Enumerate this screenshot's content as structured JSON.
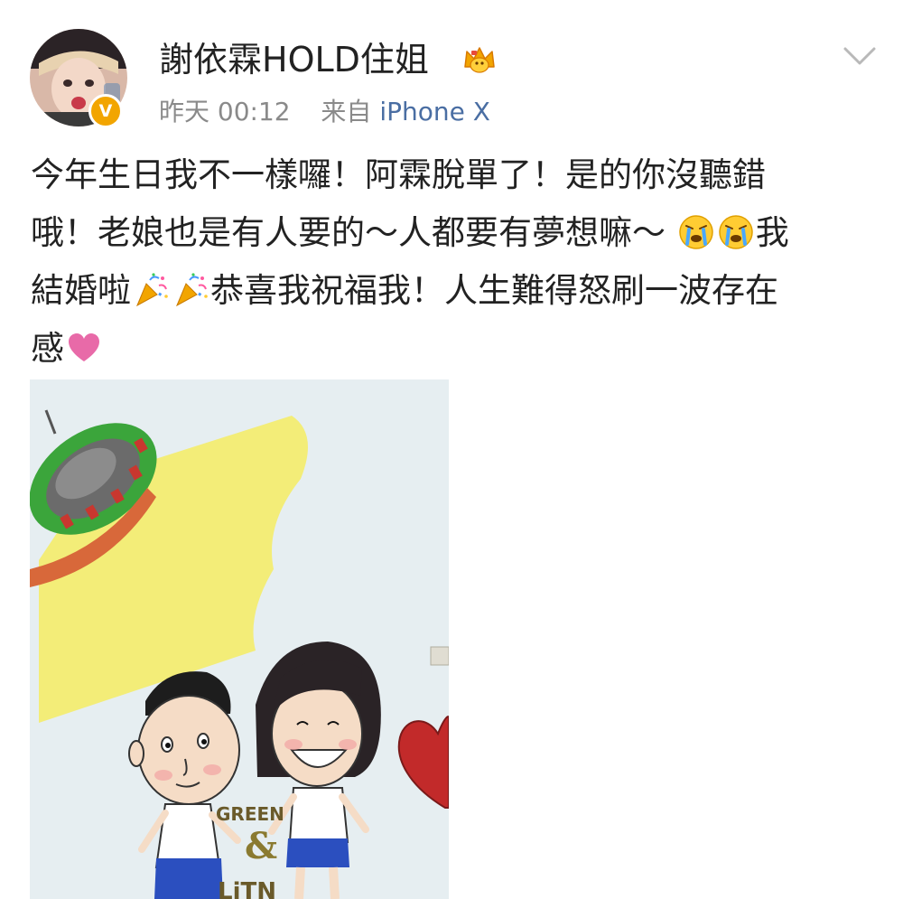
{
  "post": {
    "user_name": "謝依霖HOLD住姐",
    "time": "昨天 00:12",
    "source_prefix": "来自",
    "device": "iPhone X",
    "text_lines": [
      {
        "a": "今年生日我不一樣囉！阿霖脫單了！是的你沒聽錯"
      },
      {
        "a": "哦！老娘也是有人要的～人都要有夢想嘛～",
        "b": "我"
      },
      {
        "a": "結婚啦",
        "b": "恭喜我祝福我！人生難得怒刷一波存在"
      },
      {
        "a": "感"
      }
    ],
    "emoji": [
      "crying-face-icon",
      "crying-face-icon",
      "party-popper-icon",
      "party-popper-icon",
      "pink-heart-icon"
    ],
    "image_lettering": [
      "GREEN",
      "&",
      "LiTN"
    ]
  },
  "colors": {
    "name": "#222222",
    "meta": "#8a8a8a",
    "device_link": "#4a6ea3",
    "badge": "#f2a500",
    "heart": "#e86aa8"
  }
}
